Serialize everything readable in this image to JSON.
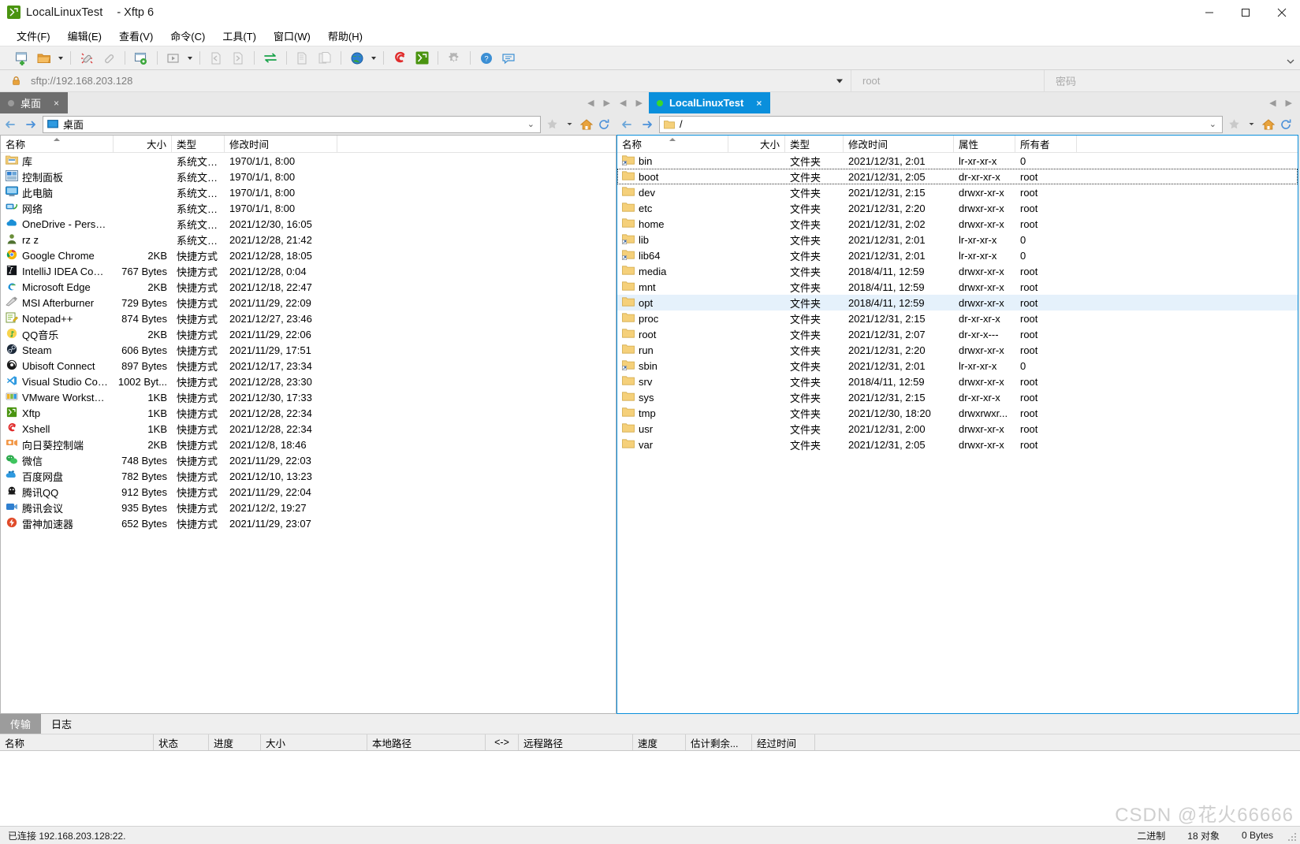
{
  "window": {
    "app_icon": "xftp-icon",
    "session_title": "LocalLinuxTest",
    "app_title": "- Xftp 6",
    "minimize": "minimize-icon",
    "maximize": "maximize-icon",
    "close": "close-icon"
  },
  "menu": {
    "items": [
      {
        "label": "文件(F)",
        "name": "menu-file"
      },
      {
        "label": "编辑(E)",
        "name": "menu-edit"
      },
      {
        "label": "查看(V)",
        "name": "menu-view"
      },
      {
        "label": "命令(C)",
        "name": "menu-command"
      },
      {
        "label": "工具(T)",
        "name": "menu-tools"
      },
      {
        "label": "窗口(W)",
        "name": "menu-window"
      },
      {
        "label": "帮助(H)",
        "name": "menu-help"
      }
    ]
  },
  "address": {
    "lock_icon": "lock-icon",
    "url": "sftp://192.168.203.128",
    "username_placeholder": "root",
    "password_placeholder": "密码"
  },
  "left_pane": {
    "tab": {
      "label": "桌面",
      "status_dot": "idle",
      "close": "×"
    },
    "path": "桌面",
    "columns": [
      {
        "key": "name",
        "label": "名称",
        "sorted": true
      },
      {
        "key": "size",
        "label": "大小"
      },
      {
        "key": "type",
        "label": "类型"
      },
      {
        "key": "time",
        "label": "修改时间"
      }
    ],
    "rows": [
      {
        "icon": "library-folder-icon",
        "name": "库",
        "size": "",
        "type": "系统文件夹",
        "time": "1970/1/1, 8:00"
      },
      {
        "icon": "control-panel-icon",
        "name": "控制面板",
        "size": "",
        "type": "系统文件夹",
        "time": "1970/1/1, 8:00"
      },
      {
        "icon": "this-pc-icon",
        "name": "此电脑",
        "size": "",
        "type": "系统文件夹",
        "time": "1970/1/1, 8:00"
      },
      {
        "icon": "network-icon",
        "name": "网络",
        "size": "",
        "type": "系统文件夹",
        "time": "1970/1/1, 8:00"
      },
      {
        "icon": "onedrive-icon",
        "name": "OneDrive - Personal",
        "size": "",
        "type": "系统文件夹",
        "time": "2021/12/30, 16:05"
      },
      {
        "icon": "user-icon",
        "name": "rz z",
        "size": "",
        "type": "系统文件夹",
        "time": "2021/12/28, 21:42"
      },
      {
        "icon": "chrome-icon",
        "name": "Google Chrome",
        "size": "2KB",
        "type": "快捷方式",
        "time": "2021/12/28, 18:05"
      },
      {
        "icon": "intellij-icon",
        "name": "IntelliJ IDEA Comm...",
        "size": "767 Bytes",
        "type": "快捷方式",
        "time": "2021/12/28, 0:04"
      },
      {
        "icon": "edge-icon",
        "name": "Microsoft Edge",
        "size": "2KB",
        "type": "快捷方式",
        "time": "2021/12/18, 22:47"
      },
      {
        "icon": "msi-afterburner-icon",
        "name": "MSI Afterburner",
        "size": "729 Bytes",
        "type": "快捷方式",
        "time": "2021/11/29, 22:09"
      },
      {
        "icon": "notepadpp-icon",
        "name": "Notepad++",
        "size": "874 Bytes",
        "type": "快捷方式",
        "time": "2021/12/27, 23:46"
      },
      {
        "icon": "qqmusic-icon",
        "name": "QQ音乐",
        "size": "2KB",
        "type": "快捷方式",
        "time": "2021/11/29, 22:06"
      },
      {
        "icon": "steam-icon",
        "name": "Steam",
        "size": "606 Bytes",
        "type": "快捷方式",
        "time": "2021/11/29, 17:51"
      },
      {
        "icon": "ubisoft-icon",
        "name": "Ubisoft Connect",
        "size": "897 Bytes",
        "type": "快捷方式",
        "time": "2021/12/17, 23:34"
      },
      {
        "icon": "vscode-icon",
        "name": "Visual Studio Code",
        "size": "1002 Byt...",
        "type": "快捷方式",
        "time": "2021/12/28, 23:30"
      },
      {
        "icon": "vmware-icon",
        "name": "VMware Workstati...",
        "size": "1KB",
        "type": "快捷方式",
        "time": "2021/12/30, 17:33"
      },
      {
        "icon": "xftp-icon",
        "name": "Xftp",
        "size": "1KB",
        "type": "快捷方式",
        "time": "2021/12/28, 22:34"
      },
      {
        "icon": "xshell-icon",
        "name": "Xshell",
        "size": "1KB",
        "type": "快捷方式",
        "time": "2021/12/28, 22:34"
      },
      {
        "icon": "sunflower-icon",
        "name": "向日葵控制端",
        "size": "2KB",
        "type": "快捷方式",
        "time": "2021/12/8, 18:46"
      },
      {
        "icon": "wechat-icon",
        "name": "微信",
        "size": "748 Bytes",
        "type": "快捷方式",
        "time": "2021/11/29, 22:03"
      },
      {
        "icon": "baidupan-icon",
        "name": "百度网盘",
        "size": "782 Bytes",
        "type": "快捷方式",
        "time": "2021/12/10, 13:23"
      },
      {
        "icon": "qq-icon",
        "name": "腾讯QQ",
        "size": "912 Bytes",
        "type": "快捷方式",
        "time": "2021/11/29, 22:04"
      },
      {
        "icon": "tencent-meeting-icon",
        "name": "腾讯会议",
        "size": "935 Bytes",
        "type": "快捷方式",
        "time": "2021/12/2, 19:27"
      },
      {
        "icon": "leigod-icon",
        "name": "雷神加速器",
        "size": "652 Bytes",
        "type": "快捷方式",
        "time": "2021/11/29, 23:07"
      }
    ]
  },
  "right_pane": {
    "tab": {
      "label": "LocalLinuxTest",
      "status_dot": "connected",
      "close": "×"
    },
    "path": "/",
    "columns": [
      {
        "key": "name",
        "label": "名称",
        "sorted": true
      },
      {
        "key": "size",
        "label": "大小"
      },
      {
        "key": "type",
        "label": "类型"
      },
      {
        "key": "time",
        "label": "修改时间"
      },
      {
        "key": "attr",
        "label": "属性"
      },
      {
        "key": "owner",
        "label": "所有者"
      }
    ],
    "rows": [
      {
        "icon": "folder-link-icon",
        "name": "bin",
        "size": "",
        "type": "文件夹",
        "time": "2021/12/31, 2:01",
        "attr": "lr-xr-xr-x",
        "owner": "0",
        "state": ""
      },
      {
        "icon": "folder-icon",
        "name": "boot",
        "size": "",
        "type": "文件夹",
        "time": "2021/12/31, 2:05",
        "attr": "dr-xr-xr-x",
        "owner": "root",
        "state": "focus"
      },
      {
        "icon": "folder-icon",
        "name": "dev",
        "size": "",
        "type": "文件夹",
        "time": "2021/12/31, 2:15",
        "attr": "drwxr-xr-x",
        "owner": "root",
        "state": ""
      },
      {
        "icon": "folder-icon",
        "name": "etc",
        "size": "",
        "type": "文件夹",
        "time": "2021/12/31, 2:20",
        "attr": "drwxr-xr-x",
        "owner": "root",
        "state": ""
      },
      {
        "icon": "folder-icon",
        "name": "home",
        "size": "",
        "type": "文件夹",
        "time": "2021/12/31, 2:02",
        "attr": "drwxr-xr-x",
        "owner": "root",
        "state": ""
      },
      {
        "icon": "folder-link-icon",
        "name": "lib",
        "size": "",
        "type": "文件夹",
        "time": "2021/12/31, 2:01",
        "attr": "lr-xr-xr-x",
        "owner": "0",
        "state": ""
      },
      {
        "icon": "folder-link-icon",
        "name": "lib64",
        "size": "",
        "type": "文件夹",
        "time": "2021/12/31, 2:01",
        "attr": "lr-xr-xr-x",
        "owner": "0",
        "state": ""
      },
      {
        "icon": "folder-icon",
        "name": "media",
        "size": "",
        "type": "文件夹",
        "time": "2018/4/11, 12:59",
        "attr": "drwxr-xr-x",
        "owner": "root",
        "state": ""
      },
      {
        "icon": "folder-icon",
        "name": "mnt",
        "size": "",
        "type": "文件夹",
        "time": "2018/4/11, 12:59",
        "attr": "drwxr-xr-x",
        "owner": "root",
        "state": ""
      },
      {
        "icon": "folder-icon",
        "name": "opt",
        "size": "",
        "type": "文件夹",
        "time": "2018/4/11, 12:59",
        "attr": "drwxr-xr-x",
        "owner": "root",
        "state": "selected"
      },
      {
        "icon": "folder-icon",
        "name": "proc",
        "size": "",
        "type": "文件夹",
        "time": "2021/12/31, 2:15",
        "attr": "dr-xr-xr-x",
        "owner": "root",
        "state": ""
      },
      {
        "icon": "folder-icon",
        "name": "root",
        "size": "",
        "type": "文件夹",
        "time": "2021/12/31, 2:07",
        "attr": "dr-xr-x---",
        "owner": "root",
        "state": ""
      },
      {
        "icon": "folder-icon",
        "name": "run",
        "size": "",
        "type": "文件夹",
        "time": "2021/12/31, 2:20",
        "attr": "drwxr-xr-x",
        "owner": "root",
        "state": ""
      },
      {
        "icon": "folder-link-icon",
        "name": "sbin",
        "size": "",
        "type": "文件夹",
        "time": "2021/12/31, 2:01",
        "attr": "lr-xr-xr-x",
        "owner": "0",
        "state": ""
      },
      {
        "icon": "folder-icon",
        "name": "srv",
        "size": "",
        "type": "文件夹",
        "time": "2018/4/11, 12:59",
        "attr": "drwxr-xr-x",
        "owner": "root",
        "state": ""
      },
      {
        "icon": "folder-icon",
        "name": "sys",
        "size": "",
        "type": "文件夹",
        "time": "2021/12/31, 2:15",
        "attr": "dr-xr-xr-x",
        "owner": "root",
        "state": ""
      },
      {
        "icon": "folder-icon",
        "name": "tmp",
        "size": "",
        "type": "文件夹",
        "time": "2021/12/30, 18:20",
        "attr": "drwxrwxr...",
        "owner": "root",
        "state": ""
      },
      {
        "icon": "folder-icon",
        "name": "usr",
        "size": "",
        "type": "文件夹",
        "time": "2021/12/31, 2:00",
        "attr": "drwxr-xr-x",
        "owner": "root",
        "state": ""
      },
      {
        "icon": "folder-icon",
        "name": "var",
        "size": "",
        "type": "文件夹",
        "time": "2021/12/31, 2:05",
        "attr": "drwxr-xr-x",
        "owner": "root",
        "state": ""
      }
    ]
  },
  "transfer_panel": {
    "tabs": [
      {
        "label": "传输",
        "active": true
      },
      {
        "label": "日志",
        "active": false
      }
    ],
    "columns": [
      "名称",
      "状态",
      "进度",
      "大小",
      "本地路径",
      "<->",
      "远程路径",
      "速度",
      "估计剩余...",
      "经过时间"
    ],
    "rows": []
  },
  "statusbar": {
    "connection": "已连接 192.168.203.128:22.",
    "transfer_mode": "二进制",
    "object_count": "18 对象",
    "total_size": "0 Bytes"
  },
  "watermark": {
    "text": "CSDN @花火66666"
  },
  "colors": {
    "accent": "#0a8fdc",
    "tab_inactive": "#6e6e6e",
    "selection": "#e5f1fb",
    "toolbar_bg": "#f0f0f0",
    "chrome_bg": "#e9e9e9"
  }
}
